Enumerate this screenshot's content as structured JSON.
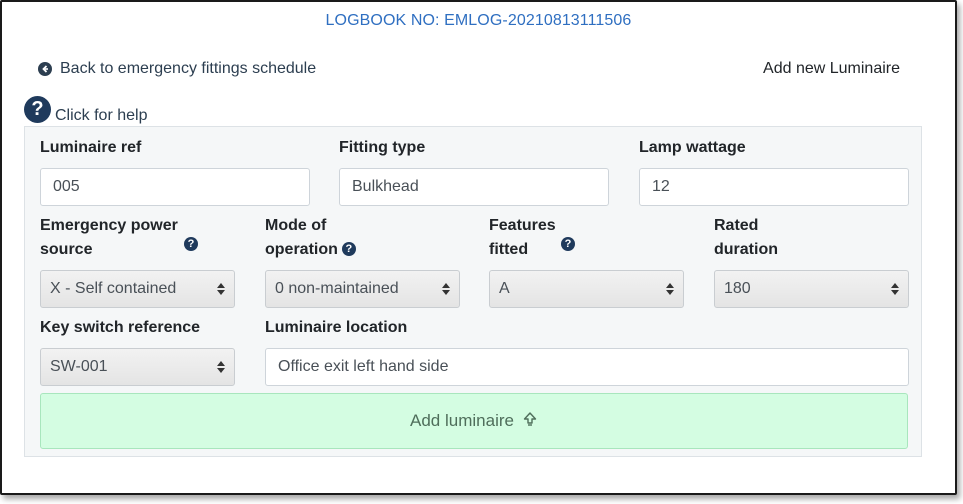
{
  "header": {
    "logbook": "LOGBOOK NO: EMLOG-20210813111506",
    "back_link": "Back to emergency fittings schedule",
    "add_new": "Add new Luminaire",
    "help": "Click for help"
  },
  "form": {
    "luminaire_ref": {
      "label": "Luminaire ref",
      "value": "005"
    },
    "fitting_type": {
      "label": "Fitting type",
      "value": "Bulkhead"
    },
    "lamp_wattage": {
      "label": "Lamp wattage",
      "value": "12"
    },
    "emergency_power_source": {
      "label_line1": "Emergency power",
      "label_line2": "source",
      "value": "X - Self contained"
    },
    "mode_of_operation": {
      "label_line1": "Mode of",
      "label_line2": "operation",
      "value": "0 non-maintained"
    },
    "features_fitted": {
      "label_line1": "Features",
      "label_line2": "fitted",
      "value": "A"
    },
    "rated_duration": {
      "label_line1": "Rated",
      "label_line2": "duration",
      "value": "180"
    },
    "key_switch_reference": {
      "label": "Key switch reference",
      "value": "SW-001"
    },
    "luminaire_location": {
      "label": "Luminaire location",
      "value": "Office exit left hand side"
    },
    "submit_label": "Add luminaire"
  },
  "icons": {
    "back": "circle-arrow-left-icon",
    "help": "question-circle-icon",
    "info": "question-circle-icon",
    "submit": "upload-arrow-icon"
  },
  "colors": {
    "link": "#2f6fc1",
    "button_bg": "#d4fde2",
    "icon_dark": "#1f3a5c"
  }
}
